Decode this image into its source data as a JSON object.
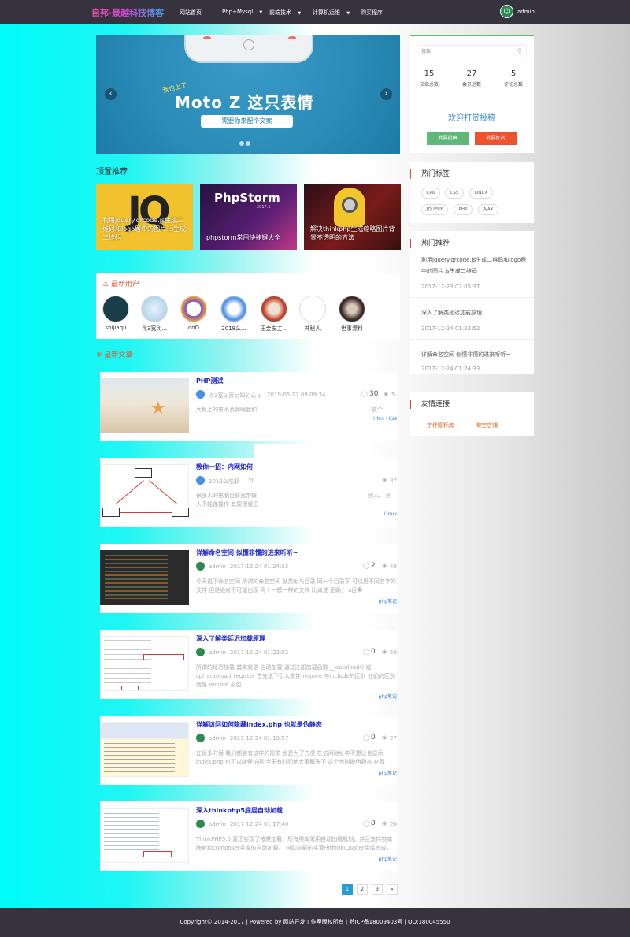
{
  "header": {
    "logo": "自邦·景越科技博客",
    "nav": [
      {
        "label": "网站首页"
      },
      {
        "label": "Php+Mysql"
      },
      {
        "label": "前端技术"
      },
      {
        "label": "计算机运维"
      },
      {
        "label": "购买程序"
      }
    ],
    "dropdown_marker": "▼",
    "username": "admin"
  },
  "slider": {
    "phone_brand": "moto",
    "tagline": "我也上了",
    "title": "Moto Z 这只表情",
    "caption": "需要你来配个文案",
    "prev": "‹",
    "next": "›"
  },
  "top_recommend": {
    "title": "顶置推荐",
    "cards": [
      {
        "caption": "利用jquery.qrcode.js生成二维码和logo居中的图片 js生成二维码",
        "colors": [
          "#f2c12e",
          "#e0a914"
        ]
      },
      {
        "caption": "phpstorm常用快捷键大全",
        "colors": [
          "#24123e",
          "#5a1e73"
        ]
      },
      {
        "caption": "解决thinkphp生成缩略图片背景不透明的方法",
        "colors": [
          "#2a0e18",
          "#7a1c1c"
        ]
      }
    ],
    "phpstorm_logo": "PhpStorm",
    "phpstorm_year": "2017.1",
    "jq_text": "JQ"
  },
  "new_users": {
    "title": "最新用户",
    "users": [
      {
        "name": "shijiaqu",
        "color": "#1a3d4a"
      },
      {
        "name": "えΞ宽え...",
        "color": "#b8d6e8"
      },
      {
        "name": "ooO",
        "color": "#7a4fc7"
      },
      {
        "name": "2018么...",
        "color": "#4a90e2"
      },
      {
        "name": "王金友工...",
        "color": "#c8462e"
      },
      {
        "name": "神秘人",
        "color": "#ffffff"
      },
      {
        "name": "世事漂料",
        "color": "#3b2a25"
      }
    ]
  },
  "latest_articles": {
    "title": "最新文章",
    "items": [
      {
        "title": "PHP测试",
        "author": "えΞ宽ぇ厉ぉ知幻心ぇ",
        "date": "2019-05-27 09:09:14",
        "comments": "30",
        "views": "5",
        "excerpt": "大概上的来不及啊眼我如",
        "excerpt_tail": "放个",
        "tag": "Html+Css",
        "thumb": [
          "#e8dccb",
          "#c9b89f"
        ]
      },
      {
        "title": "教你一招：内网如何",
        "author": "2018么吃耶",
        "date": "20",
        "comments": "",
        "views": "37",
        "excerpt": "很多人的电脑目前宽带拨",
        "excerpt2": "人不能连操作 其原理就正",
        "excerpt_tail": "别人。 别",
        "tag": "Linux",
        "thumb": [
          "#ffffff",
          "#f0f0f0"
        ]
      },
      {
        "title": "详解命名空间 似懂非懂的进来听听~",
        "author": "admin",
        "date": "2017-12-24 01:24:33",
        "comments": "2",
        "views": "48",
        "excerpt": "今天说下命名空间 所谓的命名空间 就类似与目录 同一个目录下 可以用不同名字的文件 但是绝对不可能出现 两个一模一样的文件 比如说 正确：  a目�",
        "tag": "php笔记",
        "thumb": [
          "#2b2b2b",
          "#3c3f41"
        ]
      },
      {
        "title": "深入了解类延迟加载原理",
        "author": "admin",
        "date": "2017-12-24 01:22:52",
        "comments": "0",
        "views": "50",
        "excerpt": "所谓的延迟加载 其实就是 自动加载 通过注册加载函数 __autoload() 或 spl_autoload_register 首先说下引入文件 require 与include的区别 他们的区别就是 require 系包",
        "tag": "php笔记",
        "thumb": [
          "#ffffff",
          "#f5f5f5"
        ]
      },
      {
        "title": "详解访问如何隐藏index.php 也就是伪静态",
        "author": "admin",
        "date": "2017-12-24 01:19:57",
        "comments": "0",
        "views": "27",
        "excerpt": "在很多时候 我们都会有这样的需求 也是为了方便 在访问地址中不想让也显示 index.php 也可以随便访问 今天有时间他大家解答下 这个也叫做伪静态 在我",
        "tag": "php笔记",
        "thumb": [
          "#eef3fb",
          "#fff9e0"
        ]
      },
      {
        "title": "深入thinkphp5底层自动加载",
        "author": "admin",
        "date": "2017-12-24 01:17:40",
        "comments": "0",
        "views": "20",
        "excerpt": "ThinkPHP5.0 真正实现了按需加载，所有类库采用自动加载机制，并且支持类库映射和composer类库的自动加载。  自动加载的实现由think\\Loader类库完成，自动�",
        "tag": "php笔记",
        "thumb": [
          "#ffffff",
          "#f3f6fa"
        ]
      }
    ]
  },
  "pagination": {
    "pages": [
      "1",
      "2",
      "3",
      "»"
    ]
  },
  "sidebar": {
    "search_placeholder": "搜索",
    "stats": [
      {
        "num": "15",
        "label": "文章总数"
      },
      {
        "num": "27",
        "label": "会员总数"
      },
      {
        "num": "5",
        "label": "评论总数"
      }
    ],
    "reward_title": "欢迎打赏投稿",
    "contribute_btn": "我要投稿",
    "reward_btn": "我要打赏",
    "hot_tags_title": "热门标签",
    "tags": [
      "CPU",
      "CSS",
      "LINUX",
      "JQUERY",
      "PHP",
      "AJAX"
    ],
    "hot_rec_title": "热门推荐",
    "hot_items": [
      {
        "title": "利用jquery.qrcode.js生成二维码和logo居中的图片 js生成二维码",
        "date": "2017-12-23 07:05:37"
      },
      {
        "title": "深入了解类延迟加载原理",
        "date": "2017-12-24 01:22:52"
      },
      {
        "title": "详解命名空间 似懂非懂的进来听听~",
        "date": "2017-12-24 01:24:33"
      }
    ],
    "links_title": "友情连接",
    "links": [
      "宇伴图标库",
      "淘宝店铺"
    ]
  },
  "footer": {
    "text": "Copyright© 2014-2017  |  Powered by 网站开发工作室版权所有  |  黔ICP备18009403号  |  QQ:180045550"
  }
}
